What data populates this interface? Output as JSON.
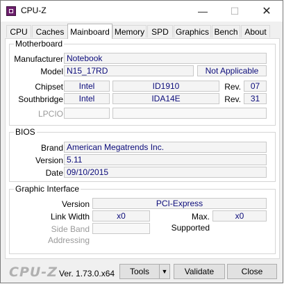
{
  "window": {
    "title": "CPU-Z",
    "min_glyph": "—",
    "max_glyph": "☐",
    "close_glyph": "✕"
  },
  "tabs": [
    "CPU",
    "Caches",
    "Mainboard",
    "Memory",
    "SPD",
    "Graphics",
    "Bench",
    "About"
  ],
  "active_tab": "Mainboard",
  "motherboard": {
    "group_title": "Motherboard",
    "manufacturer_label": "Manufacturer",
    "manufacturer": "Notebook",
    "model_label": "Model",
    "model": "N15_17RD",
    "model_extra": "Not Applicable",
    "chipset_label": "Chipset",
    "chipset_vendor": "Intel",
    "chipset_name": "ID1910",
    "chipset_rev_label": "Rev.",
    "chipset_rev": "07",
    "southbridge_label": "Southbridge",
    "southbridge_vendor": "Intel",
    "southbridge_name": "IDA14E",
    "southbridge_rev_label": "Rev.",
    "southbridge_rev": "31",
    "lpcio_label": "LPCIO",
    "lpcio_vendor": "",
    "lpcio_name": ""
  },
  "bios": {
    "group_title": "BIOS",
    "brand_label": "Brand",
    "brand": "American Megatrends Inc.",
    "version_label": "Version",
    "version": "5.11",
    "date_label": "Date",
    "date": "09/10/2015"
  },
  "graphic_interface": {
    "group_title": "Graphic Interface",
    "version_label": "Version",
    "version": "PCI-Express",
    "link_width_label": "Link Width",
    "link_width": "x0",
    "max_supported_label": "Max. Supported",
    "max_supported": "x0",
    "side_band_label": "Side Band Addressing",
    "side_band": ""
  },
  "footer": {
    "brand": "CPU-Z",
    "version": "Ver. 1.73.0.x64",
    "tools_label": "Tools",
    "tools_arrow": "▼",
    "validate_label": "Validate",
    "close_label": "Close"
  }
}
